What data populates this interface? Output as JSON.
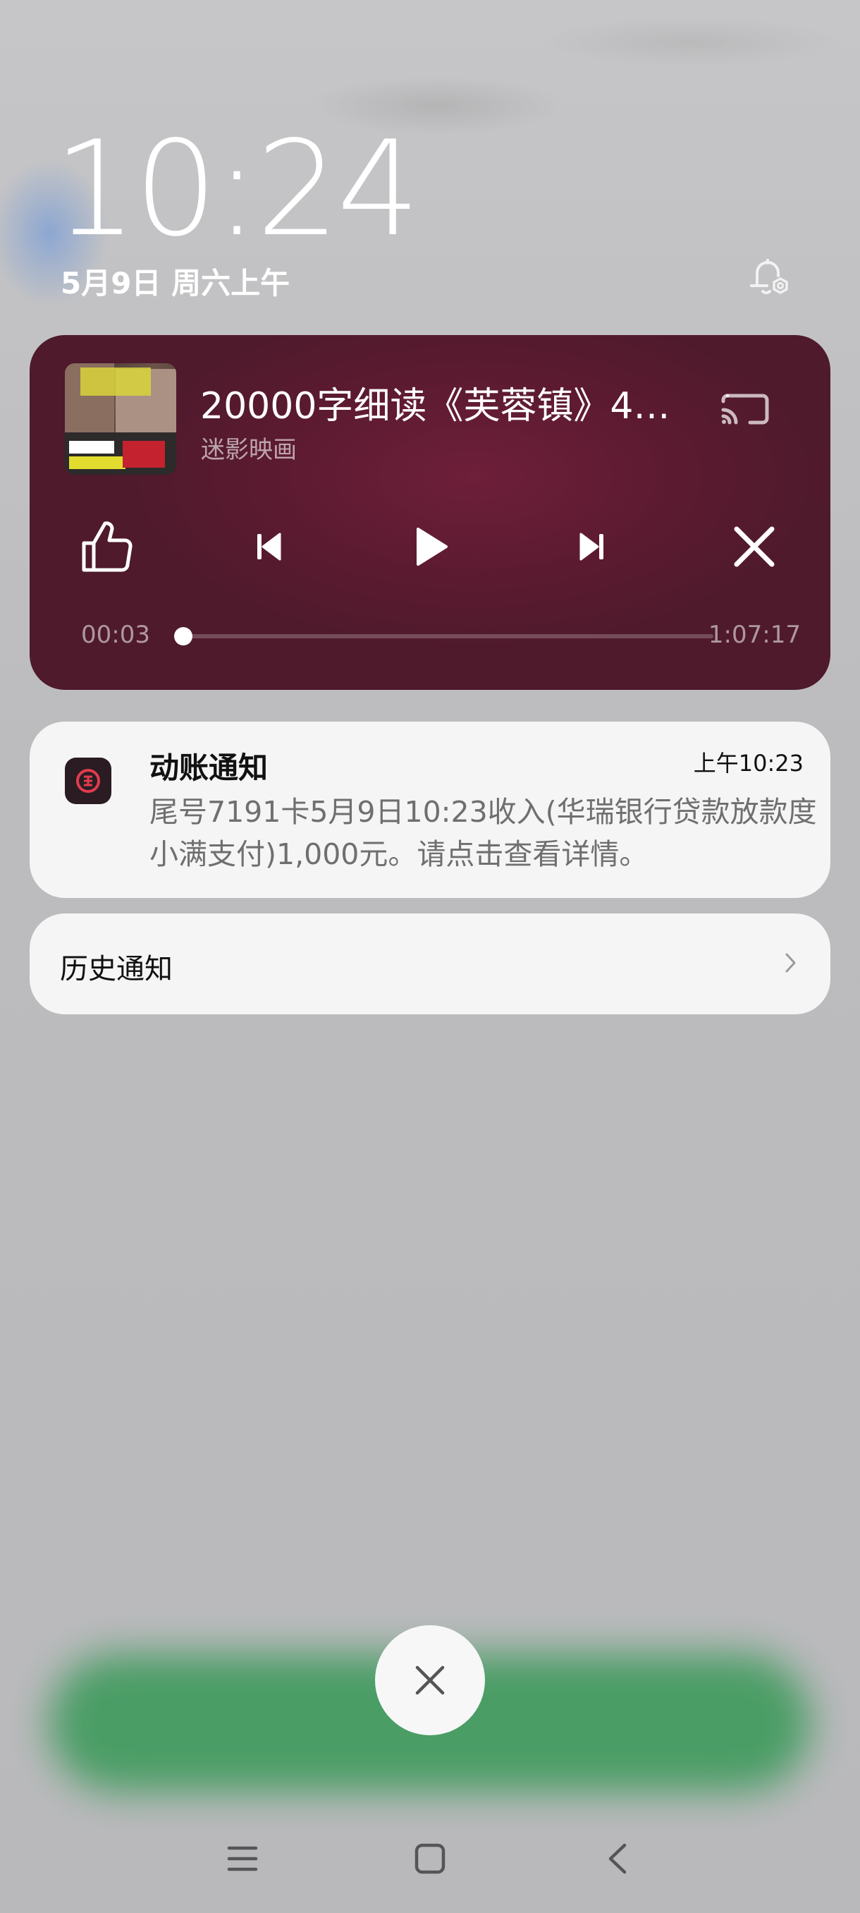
{
  "lockscreen": {
    "time": "10:24",
    "date": "5月9日 周六上午"
  },
  "media": {
    "title": "20000字细读《芙蓉镇》4…",
    "artist": "迷影映画",
    "elapsed": "00:03",
    "duration": "1:07:17",
    "progress_fraction": 0.0,
    "accent_color": "#5e1b33",
    "controls": [
      "like-icon",
      "previous-icon",
      "play-icon",
      "next-icon",
      "close-icon"
    ]
  },
  "notification": {
    "title": "动账通知",
    "time": "上午10:23",
    "body": "尾号7191卡5月9日10:23收入(华瑞银行贷款放款度小满支付)1,000元。请点击查看详情。"
  },
  "history": {
    "label": "历史通知"
  },
  "navigation": {
    "buttons": [
      "menu-icon",
      "home-icon",
      "back-icon"
    ]
  }
}
